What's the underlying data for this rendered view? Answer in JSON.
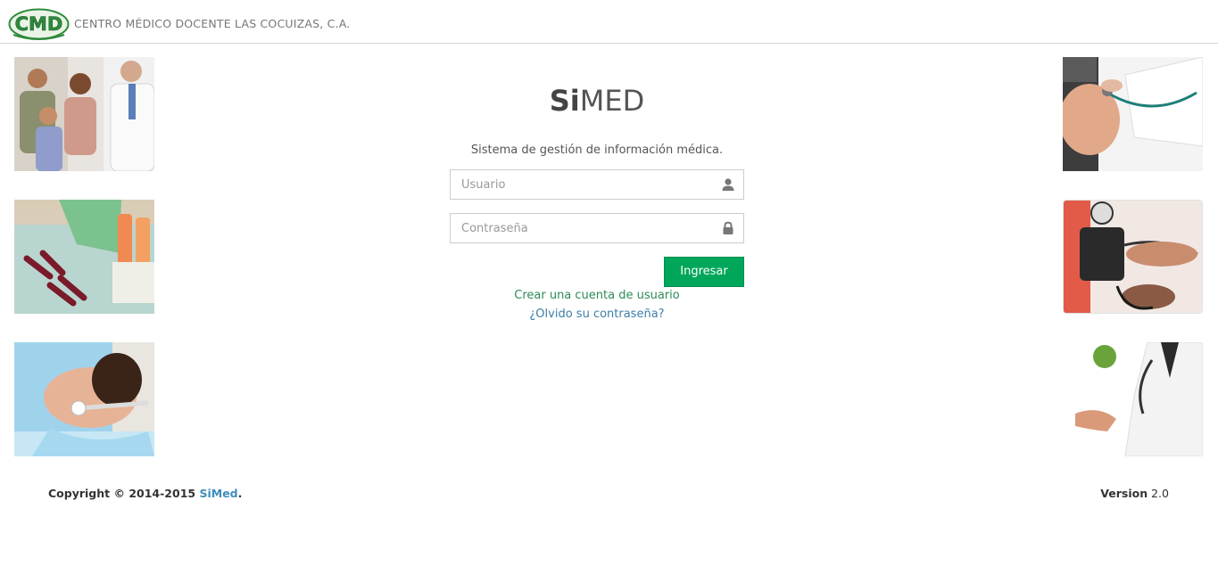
{
  "header": {
    "logo_text": "CMD",
    "organization": "CENTRO MÉDICO DOCENTE LAS COCUIZAS, C.A."
  },
  "app": {
    "title_bold": "Si",
    "title_light": "MED",
    "subtitle": "Sistema de gestión de información médica."
  },
  "form": {
    "username_placeholder": "Usuario",
    "username_value": "",
    "username_icon": "user-icon",
    "password_placeholder": "Contraseña",
    "password_value": "",
    "password_icon": "lock-icon",
    "submit_label": "Ingresar"
  },
  "links": {
    "create_account": "Crear una cuenta de usuario",
    "forgot_password": "¿Olvido su contraseña?"
  },
  "footer": {
    "copyright_prefix": "Copyright © 2014-2015",
    "copyright_brand": "SiMed",
    "copyright_suffix": ".",
    "version_label": "Version",
    "version_value": "2.0"
  },
  "colors": {
    "accent_green": "#00a65a",
    "link_green": "#2e8b57",
    "link_blue": "#3c7fa8",
    "brand_blue": "#3c8dbc",
    "logo_green": "#2e8b3d"
  }
}
